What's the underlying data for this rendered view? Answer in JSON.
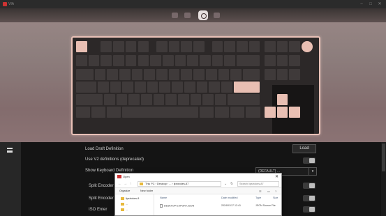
{
  "window": {
    "title": "VIA"
  },
  "settings": {
    "rows": [
      {
        "label": "Load Draft Definition",
        "control": "button",
        "button_label": "Load"
      },
      {
        "label": "Use V2 definitions (deprecated)",
        "control": "toggle"
      },
      {
        "label": "Show Keyboard Definition",
        "control": "dropdown",
        "value": "(DEFAULT) ..."
      },
      {
        "label": "Split Encoder",
        "control": "toggle"
      },
      {
        "label": "Split Encoder",
        "control": "toggle"
      },
      {
        "label": "ISO Enter",
        "control": "toggle"
      }
    ]
  },
  "dialog": {
    "title": "Open",
    "path": [
      "This PC",
      "Desktop",
      "...",
      "lipstrokes-87"
    ],
    "search_placeholder": "Search lipstrokes-87",
    "toolbar": {
      "organize": "Organize",
      "new_folder": "New folder"
    },
    "tree": [
      "lipstrokes-8",
      "...",
      "..."
    ],
    "columns": [
      "Name",
      "Date modified",
      "Type",
      "Size"
    ],
    "files": [
      {
        "name": "DESKTOP-EXPORT.JSON",
        "modified": "2024/01/17 12:41",
        "type": "JSON Source File",
        "size": ""
      }
    ]
  },
  "colors": {
    "accent": "#e9bfb3",
    "key": "#3f3a3a",
    "frame": "#e9c1b7"
  }
}
